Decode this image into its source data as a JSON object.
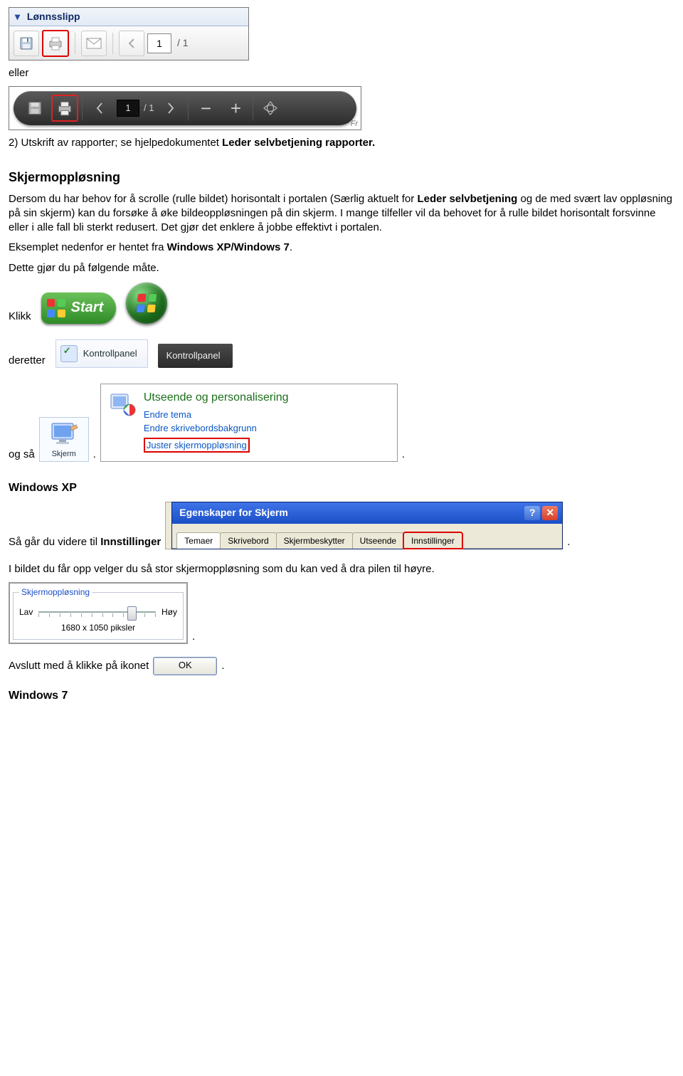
{
  "toolbar1": {
    "title": "Lønnsslipp",
    "page_current": "1",
    "page_total": "/ 1"
  },
  "toolbar2": {
    "page_current": "1",
    "page_total": "/ 1",
    "footnote": "Fr"
  },
  "text": {
    "eller": "eller",
    "line2a": "2) Utskrift av rapporter; se hjelpedokumentet ",
    "line2b": "Leder selvbetjening rapporter.",
    "h_skjerm": "Skjermoppløsning",
    "para1a": "Dersom du har behov for å scrolle (rulle bildet) horisontalt i portalen (Særlig aktuelt for ",
    "para1b": "Leder selvbetjening",
    "para1c": " og de med svært lav oppløsning på sin skjerm) kan du forsøke å øke bildeoppløsningen på din skjerm. I mange tilfeller vil da behovet for å rulle bildet horisontalt forsvinne eller i alle fall bli sterkt redusert. Det gjør det enklere å jobbe effektivt i portalen.",
    "para2a": "Eksemplet nedenfor er hentet fra ",
    "para2b": "Windows XP/Windows 7",
    "para2c": ".",
    "para3": "Dette gjør du på følgende måte.",
    "klikk": "Klikk",
    "start_label": "Start",
    "deretter": "deretter",
    "cp_label": "Kontrollpanel",
    "og_sa": "og så",
    "skjerm_label": "Skjerm",
    "dot": ".",
    "utseende_hd": "Utseende og personalisering",
    "utseende_l1": "Endre tema",
    "utseende_l2": "Endre skrivebordsbakgrunn",
    "utseende_l3": "Juster skjermoppløsning",
    "h_xp": "Windows XP",
    "xp_line_a": "Så går du videre til ",
    "xp_line_b": "Innstillinger",
    "xp_win_title": "Egenskaper for Skjerm",
    "xp_tabs": {
      "t1": "Temaer",
      "t2": "Skrivebord",
      "t3": "Skjermbeskytter",
      "t4": "Utseende",
      "t5": "Innstillinger"
    },
    "xp_after": "I bildet du får opp velger du så stor skjermoppløsning som du kan ved å dra pilen til høyre.",
    "res_legend": "Skjermoppløsning",
    "res_low": "Lav",
    "res_high": "Høy",
    "res_value": "1680 x 1050 piksler",
    "avslutt": "Avslutt med å klikke på ikonet",
    "ok": "OK",
    "h_7": "Windows 7"
  }
}
